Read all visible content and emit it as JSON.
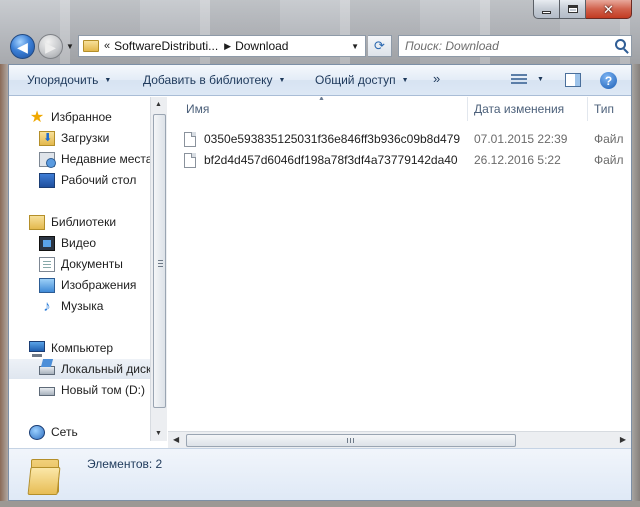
{
  "window": {
    "buttons": {
      "minimize": "minimize",
      "maximize": "maximize",
      "close": "✕"
    }
  },
  "nav": {
    "back_arrow": "◀",
    "forward_arrow": "▶",
    "history_caret": "▼"
  },
  "address": {
    "overflow": "«",
    "segments": [
      "SoftwareDistributi...",
      "Download"
    ],
    "separator": "▶",
    "dropdown": "▼",
    "refresh_glyph": "⟳"
  },
  "search": {
    "placeholder": "Поиск: Download"
  },
  "toolbar": {
    "organize_label": "Упорядочить",
    "add_to_library_label": "Добавить в библиотеку",
    "share_label": "Общий доступ",
    "more_label": "»",
    "caret": "▼",
    "help_label": "?"
  },
  "navpane": {
    "favorites": "Избранное",
    "downloads": "Загрузки",
    "recent": "Недавние места",
    "desktop": "Рабочий стол",
    "libraries": "Библиотеки",
    "video": "Видео",
    "documents": "Документы",
    "images": "Изображения",
    "music": "Музыка",
    "computer": "Компьютер",
    "local_disk": "Локальный диск",
    "new_volume": "Новый том (D:)",
    "network": "Сеть"
  },
  "columns": {
    "name": "Имя",
    "date": "Дата изменения",
    "type": "Тип",
    "sort_indicator": "▲"
  },
  "files": [
    {
      "name": "0350e593835125031f36e846ff3b936c09b8d479",
      "date": "07.01.2015 22:39",
      "type": "Файл"
    },
    {
      "name": "bf2d4d457d6046df198a78f3df4a73779142da40",
      "date": "26.12.2016 5:22",
      "type": "Файл"
    }
  ],
  "details": {
    "items_count": "Элементов: 2"
  },
  "colors": {
    "accent": "#1e395b",
    "selection": "#dfe6ef",
    "toolbar_bg": "#e3ecf7"
  },
  "icons": {
    "favorites": "star-icon",
    "downloads": "downloads-folder-icon",
    "recent": "recent-places-icon",
    "desktop": "desktop-icon",
    "libraries": "libraries-icon",
    "video": "video-library-icon",
    "documents": "documents-library-icon",
    "images": "pictures-library-icon",
    "music": "music-library-icon",
    "computer": "computer-icon",
    "local_disk": "system-drive-icon",
    "new_volume": "drive-icon",
    "network": "network-icon",
    "file": "file-icon",
    "search": "search-icon"
  }
}
